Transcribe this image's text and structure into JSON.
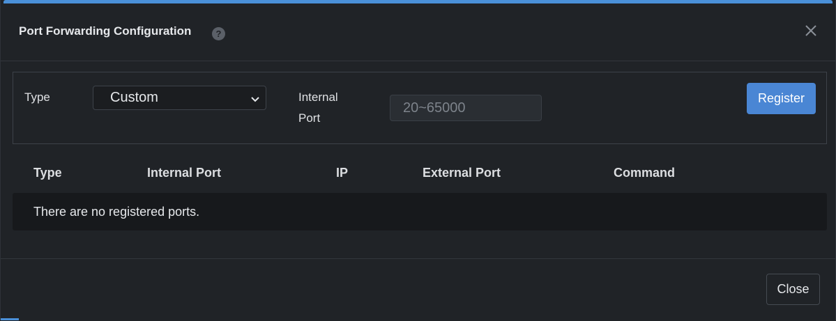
{
  "dialog": {
    "title": "Port Forwarding Configuration",
    "help_icon": "question-circle-icon",
    "close_icon": "close-icon"
  },
  "form": {
    "type_label": "Type",
    "type_select": {
      "selected": "Custom",
      "icon": "chevron-down-icon"
    },
    "internal_port_label_line1": "Internal",
    "internal_port_label_line2": "Port",
    "internal_port_input": {
      "value": "",
      "placeholder": "20~65000"
    },
    "register_label": "Register"
  },
  "table": {
    "columns": [
      "Type",
      "Internal Port",
      "IP",
      "External Port",
      "Command"
    ],
    "empty_message": "There are no registered ports."
  },
  "footer": {
    "close_label": "Close"
  },
  "colors": {
    "accent": "#4a90d9",
    "register_button": "#4a86d4",
    "background": "#202327"
  }
}
